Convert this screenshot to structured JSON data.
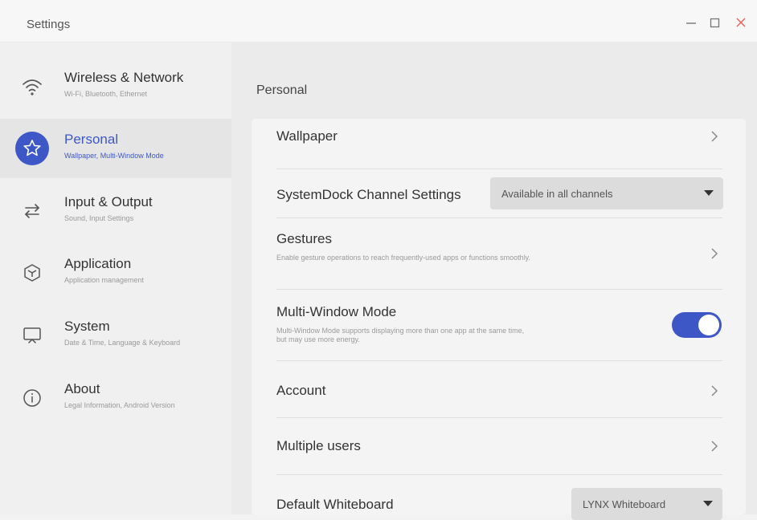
{
  "window": {
    "title": "Settings",
    "controls": [
      "minimize-icon",
      "maximize-icon",
      "close-icon"
    ],
    "close_color": "#e06666"
  },
  "colors": {
    "accent": "#3d57c7"
  },
  "sidebar": {
    "items": [
      {
        "label": "Wireless & Network",
        "sub": "Wi-Fi, Bluetooth, Ethernet",
        "icon": "wifi-icon",
        "active": false
      },
      {
        "label": "Personal",
        "sub": "Wallpaper, Multi-Window Mode",
        "icon": "star-icon",
        "active": true
      },
      {
        "label": "Input & Output",
        "sub": "Sound, Input Settings",
        "icon": "swap-arrows-icon",
        "active": false
      },
      {
        "label": "Application",
        "sub": "Application management",
        "icon": "cube-icon",
        "active": false
      },
      {
        "label": "System",
        "sub": "Date & Time, Language & Keyboard",
        "icon": "monitor-icon",
        "active": false
      },
      {
        "label": "About",
        "sub": "Legal Information, Android Version",
        "icon": "info-icon",
        "active": false
      }
    ]
  },
  "main": {
    "title": "Personal",
    "rows": {
      "wallpaper": {
        "label": "Wallpaper"
      },
      "systemdock": {
        "label": "SystemDock Channel Settings",
        "value": "Available in all channels"
      },
      "gestures": {
        "label": "Gestures",
        "desc": "Enable gesture operations to reach frequently-used apps or functions smoothly."
      },
      "multiwindow": {
        "label": "Multi-Window Mode",
        "desc": "Multi-Window Mode supports displaying more than one app at the same time, but may use more energy.",
        "enabled": true
      },
      "account": {
        "label": "Account"
      },
      "users": {
        "label": "Multiple users"
      },
      "whiteboard": {
        "label": "Default Whiteboard",
        "value": "LYNX Whiteboard"
      }
    }
  }
}
